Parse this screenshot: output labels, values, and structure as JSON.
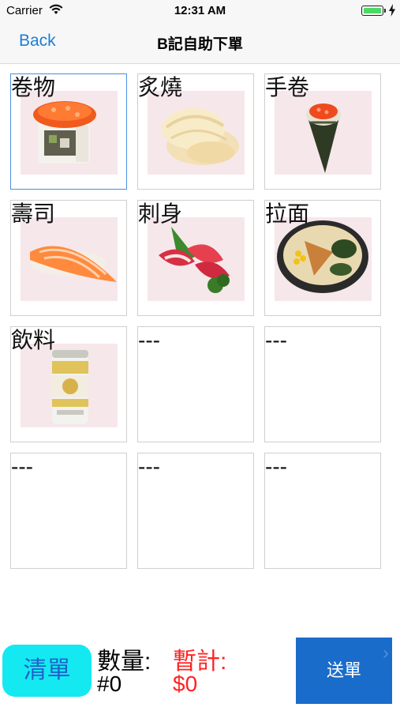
{
  "status_bar": {
    "carrier": "Carrier",
    "time": "12:31 AM"
  },
  "nav": {
    "back_label": "Back",
    "title": "B記自助下單"
  },
  "grid": {
    "cells": [
      {
        "label": "卷物",
        "image": "maki-roll"
      },
      {
        "label": "炙燒",
        "image": "aburi-scallop"
      },
      {
        "label": "手卷",
        "image": "temaki-cone"
      },
      {
        "label": "壽司",
        "image": "salmon-nigiri"
      },
      {
        "label": "刺身",
        "image": "sashimi-plate"
      },
      {
        "label": "拉面",
        "image": "ramen-bowl"
      },
      {
        "label": "飲料",
        "image": "beer-can"
      },
      {
        "label": "---",
        "image": ""
      },
      {
        "label": "---",
        "image": ""
      },
      {
        "label": "---",
        "image": ""
      },
      {
        "label": "---",
        "image": ""
      },
      {
        "label": "---",
        "image": ""
      }
    ]
  },
  "footer": {
    "clear_label": "清單",
    "qty_label": "數量:",
    "qty_value": "#0",
    "subtotal_label": "暫計:",
    "subtotal_value": "$0",
    "submit_label": "送單"
  },
  "colors": {
    "accent": "#1a7fd6",
    "clear_bg": "#14e9f2",
    "submit_bg": "#1a6ccb",
    "subtotal": "#ff2222"
  }
}
